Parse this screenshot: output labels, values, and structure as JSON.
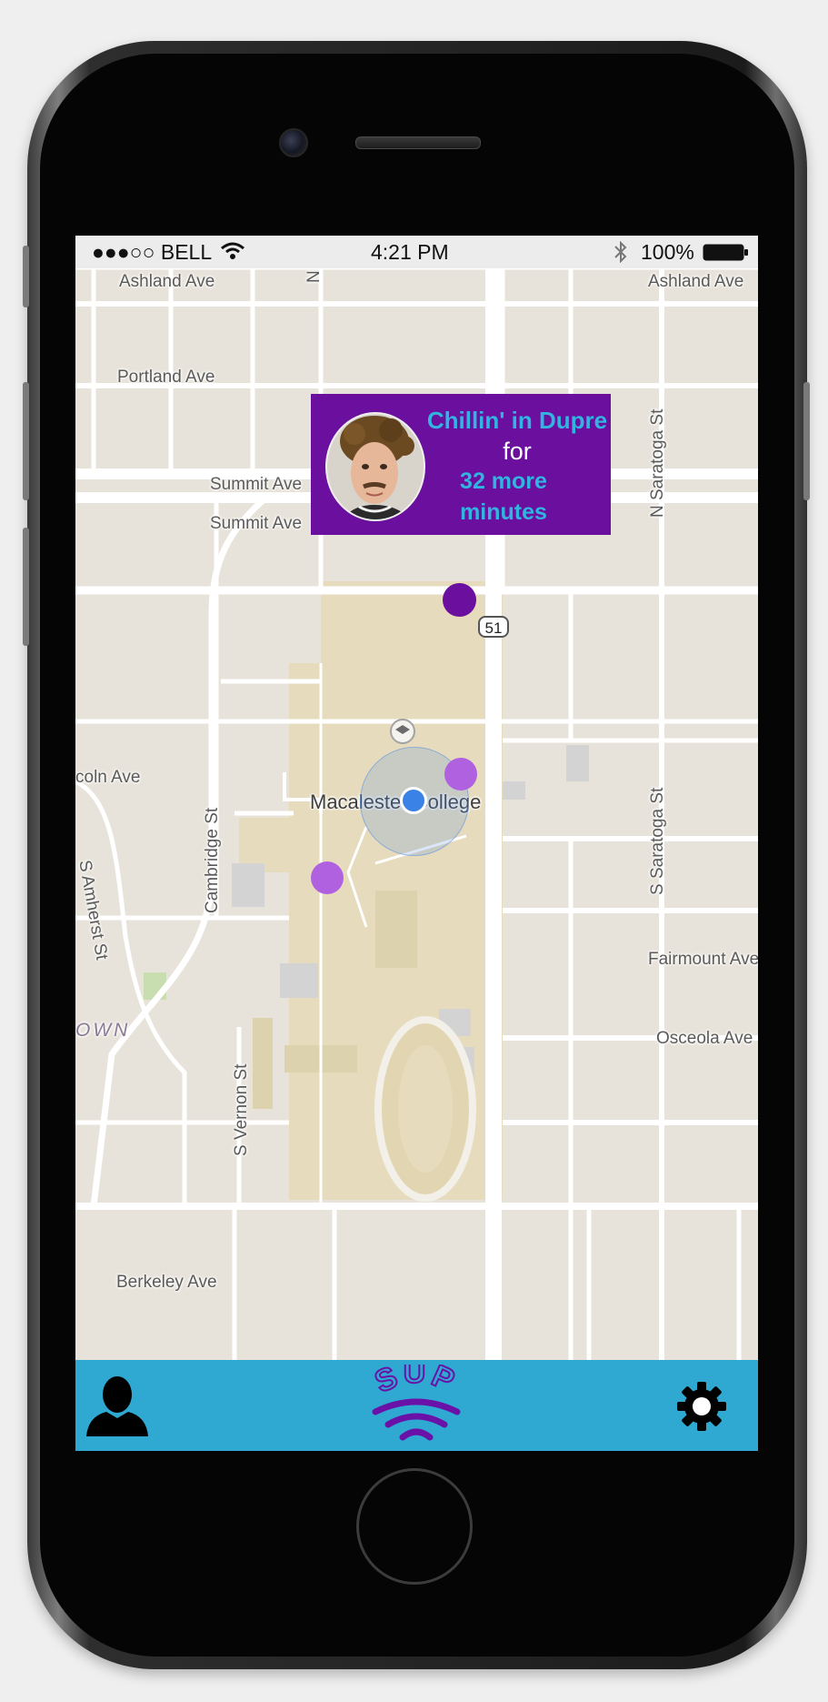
{
  "status_bar": {
    "carrier": "●●●○○ BELL",
    "time": "4:21 PM",
    "battery": "100%",
    "icons": [
      "wifi-icon",
      "bluetooth-icon",
      "battery-icon"
    ]
  },
  "map": {
    "streets": {
      "ashland_left": "Ashland Ave",
      "ashland_right": "Ashland Ave",
      "portland": "Portland Ave",
      "summit_1": "Summit Ave",
      "summit_2": "Summit Ave",
      "lincoln": "coln Ave",
      "cambridge": "Cambridge St",
      "amherst": "S Amherst St",
      "n_saratoga": "N Saratoga St",
      "s_saratoga": "S Saratoga St",
      "fairmount": "Fairmount Ave",
      "osceola": "Osceola Ave",
      "vernon": "S Vernon St",
      "berkeley": "Berkeley Ave",
      "north_top": "N",
      "town": "OWN"
    },
    "route_shield": "51",
    "poi_label": "Macalester College"
  },
  "popup": {
    "line1": "Chillin' in Dupre",
    "line2": "for",
    "line3": "32 more",
    "line4": "minutes"
  },
  "tab_bar": {
    "logo_text": "SUP",
    "profile_icon": "person-icon",
    "settings_icon": "gear-icon"
  },
  "colors": {
    "popup_bg": "#6a0f9e",
    "popup_accent": "#33b4e0",
    "tab_bar": "#2fa8d2",
    "logo_purple": "#6a12a8",
    "marker_dark": "#6a0f9e",
    "marker_light": "#b061e0",
    "location_blue": "#3b82e6"
  }
}
